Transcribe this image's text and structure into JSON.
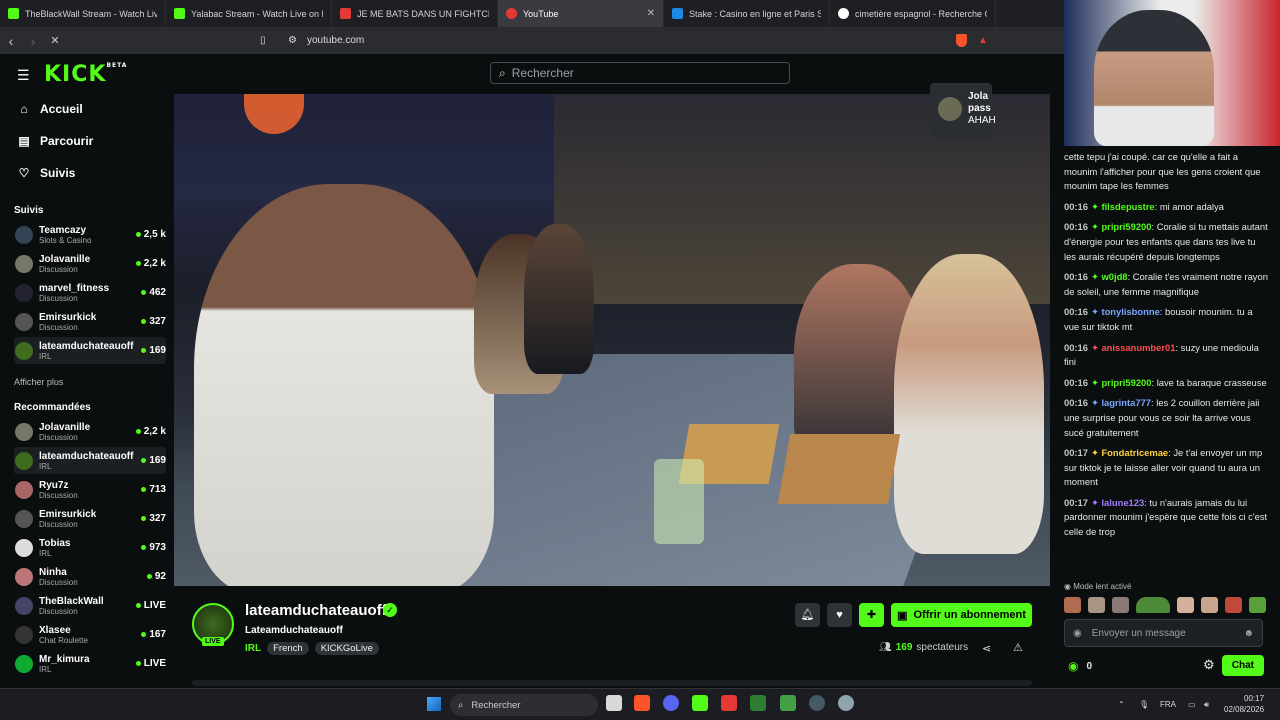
{
  "browser": {
    "tabs": [
      {
        "title": "TheBlackWall Stream - Watch Live on",
        "color": "#53fc18"
      },
      {
        "title": "Yalabac Stream - Watch Live on Kick",
        "color": "#53fc18"
      },
      {
        "title": "JE ME BATS DANS UN FIGHTCLUB",
        "color": "#e53935"
      },
      {
        "title": "YouTube",
        "color": "#e53935"
      },
      {
        "title": "Stake : Casino en ligne et Paris Sportifs",
        "color": "#1e88e5"
      },
      {
        "title": "cimetière espagnol - Recherche Google",
        "color": "#fbbc05"
      }
    ],
    "url": "youtube.com"
  },
  "kick": {
    "logo": "KICK",
    "logo_badge": "BETA",
    "search_placeholder": "Rechercher",
    "nav": [
      {
        "label": "Accueil",
        "icon": "home-icon"
      },
      {
        "label": "Parcourir",
        "icon": "browse-icon"
      },
      {
        "label": "Suivis",
        "icon": "heart-icon"
      }
    ],
    "followed_title": "Suivis",
    "followed": [
      {
        "name": "Teamcazy",
        "cat": "Slots & Casino",
        "viewers": "2,5 k",
        "color": "#345"
      },
      {
        "name": "Jolavanille",
        "cat": "Discussion",
        "viewers": "2,2 k",
        "color": "#776"
      },
      {
        "name": "marvel_fitness",
        "cat": "Discussion",
        "viewers": "462",
        "color": "#223"
      },
      {
        "name": "Emirsurkick",
        "cat": "Discussion",
        "viewers": "327",
        "color": "#555"
      },
      {
        "name": "lateamduchateauoff",
        "cat": "IRL",
        "viewers": "169",
        "color": "#3e6b1e"
      }
    ],
    "show_more": "Afficher plus",
    "recommended_title": "Recommandées",
    "recommended": [
      {
        "name": "Jolavanille",
        "cat": "Discussion",
        "viewers": "2,2 k",
        "color": "#776"
      },
      {
        "name": "lateamduchateauoff",
        "cat": "IRL",
        "viewers": "169",
        "color": "#3e6b1e"
      },
      {
        "name": "Ryu7z",
        "cat": "Discussion",
        "viewers": "713",
        "color": "#a66"
      },
      {
        "name": "Emirsurkick",
        "cat": "Discussion",
        "viewers": "327",
        "color": "#555"
      },
      {
        "name": "Tobias",
        "cat": "IRL",
        "viewers": "973",
        "color": "#ddd"
      },
      {
        "name": "Ninha",
        "cat": "Discussion",
        "viewers": "92",
        "color": "#b77"
      },
      {
        "name": "TheBlackWall",
        "cat": "Discussion",
        "viewers": "LIVE",
        "color": "#446"
      },
      {
        "name": "Xlasee",
        "cat": "Chat Roulette",
        "viewers": "167",
        "color": "#333"
      },
      {
        "name": "Mr_kimura",
        "cat": "IRL",
        "viewers": "LIVE",
        "color": "#1a3"
      }
    ],
    "overlay_name": "Jola",
    "overlay_line": "pass",
    "overlay_line2": "AHAH"
  },
  "stream": {
    "streamer": "lateamduchateauoff",
    "live_badge": "LIVE",
    "title": "Lateamduchateauoff",
    "category": "IRL",
    "tags": [
      "French",
      "KICKGoLive"
    ],
    "subscribe": "Offrir un abonnement",
    "viewers_count": "169",
    "viewers_label": "spectateurs"
  },
  "chat": {
    "messages": [
      {
        "time": "",
        "user": "",
        "color": "",
        "text": "cette tepu j'ai coupé. car ce qu'elle a fait a mounim l'afficher pour que les gens croient que mounim tape les femmes"
      },
      {
        "time": "00:16",
        "user": "filsdepustre",
        "color": "#53fc18",
        "text": "mi amor adalya"
      },
      {
        "time": "00:16",
        "user": "pripri59200",
        "color": "#53fc18",
        "text": "Coralie si tu mettais autant d'énergie pour tes enfants que dans tes live tu les aurais récupéré depuis longtemps"
      },
      {
        "time": "00:16",
        "user": "w0jd8",
        "color": "#53fc18",
        "text": "Coralie t'es vraiment notre rayon de soleil, une femme magnifique"
      },
      {
        "time": "00:16",
        "user": "tonylisbonne",
        "color": "#7aa6ff",
        "text": "bousoir mounim. tu a vue sur tiktok mt"
      },
      {
        "time": "00:16",
        "user": "anissanumber01",
        "color": "#ff4d4d",
        "text": "suzy une medioula fini"
      },
      {
        "time": "00:16",
        "user": "pripri59200",
        "color": "#53fc18",
        "text": "lave ta baraque crasseuse"
      },
      {
        "time": "00:16",
        "user": "lagrinta777",
        "color": "#7aa6ff",
        "text": "les 2 couillon derrière jaii une surprise pour vous ce soir lta arrive vous sucé gratuitement"
      },
      {
        "time": "00:17",
        "user": "Fondatricemae",
        "color": "#ffd23d",
        "text": "Je t'ai envoyer un mp sur tiktok je te laisse aller voir quand tu aura un moment"
      },
      {
        "time": "00:17",
        "user": "lalune123",
        "color": "#a07cff",
        "text": "tu n'aurais jamais du lui pardonner mounim j'espère que cette fois ci c'est celle de trop"
      }
    ],
    "slow_mode": "Mode lent activé",
    "input_placeholder": "Envoyer un message",
    "points": "0",
    "chat_button": "Chat"
  },
  "taskbar": {
    "search": "Rechercher",
    "lang": "FRA",
    "time": "00:17",
    "date": "02/08/2026"
  }
}
